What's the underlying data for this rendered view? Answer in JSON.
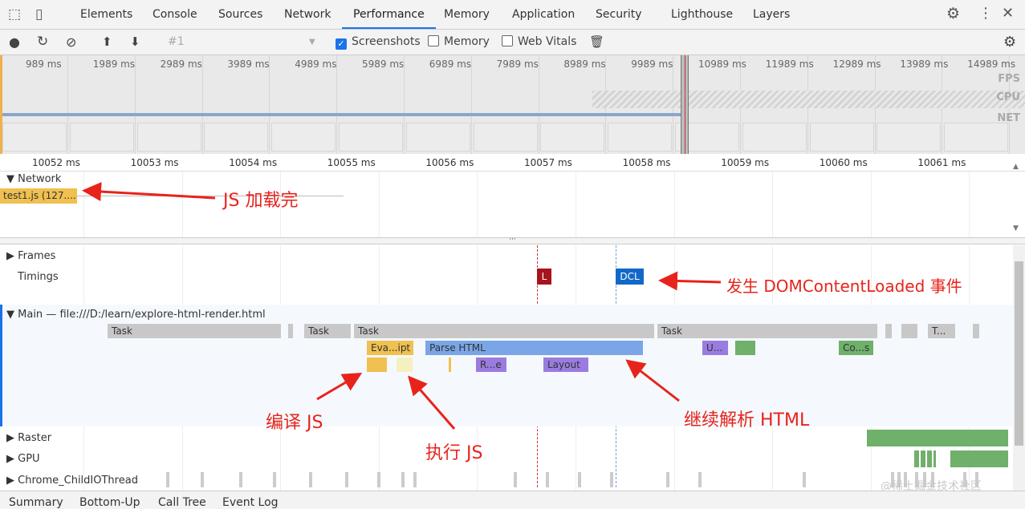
{
  "tabs": [
    "Elements",
    "Console",
    "Sources",
    "Network",
    "Performance",
    "Memory",
    "Application",
    "Security",
    "Lighthouse",
    "Layers"
  ],
  "active_tab": "Performance",
  "toolbar": {
    "recording": "#1",
    "screenshots": "Screenshots",
    "memory": "Memory",
    "web_vitals": "Web Vitals",
    "screenshots_checked": true,
    "memory_checked": false,
    "web_vitals_checked": false
  },
  "overview": {
    "ticks": [
      "989 ms",
      "1989 ms",
      "2989 ms",
      "3989 ms",
      "4989 ms",
      "5989 ms",
      "6989 ms",
      "7989 ms",
      "8989 ms",
      "9989 ms",
      "10989 ms",
      "11989 ms",
      "12989 ms",
      "13989 ms",
      "14989 ms"
    ],
    "fps": "FPS",
    "cpu": "CPU",
    "net": "NET"
  },
  "ruler": [
    "10052 ms",
    "10053 ms",
    "10054 ms",
    "10055 ms",
    "10056 ms",
    "10057 ms",
    "10058 ms",
    "10059 ms",
    "10060 ms",
    "10061 ms"
  ],
  "network": {
    "label": "Network",
    "request": "test1.js (127...."
  },
  "tracks": {
    "frames": "Frames",
    "timings": "Timings",
    "main": "Main — file:///D:/learn/explore-html-render.html",
    "raster": "Raster",
    "gpu": "GPU",
    "io": "Chrome_ChildIOThread"
  },
  "markers": {
    "l": "L",
    "dcl": "DCL"
  },
  "main_bars": {
    "task1": "Task",
    "task2": "Task",
    "task3": "Task",
    "task4": "Task",
    "task5": "T...",
    "eval": "Eva...ipt",
    "parse": "Parse HTML",
    "recalc": "R...e",
    "layout": "Layout",
    "u": "U...",
    "co": "Co...s"
  },
  "annotations": {
    "js_loaded": "JS 加载完",
    "dcl_event": "发生 DOMContentLoaded 事件",
    "compile": "编译 JS",
    "execute": "执行 JS",
    "continue_parse": "继续解析 HTML"
  },
  "bottom_tabs": [
    "Summary",
    "Bottom-Up",
    "Call Tree",
    "Event Log"
  ],
  "watermark": "@稀土掘金技术社区"
}
